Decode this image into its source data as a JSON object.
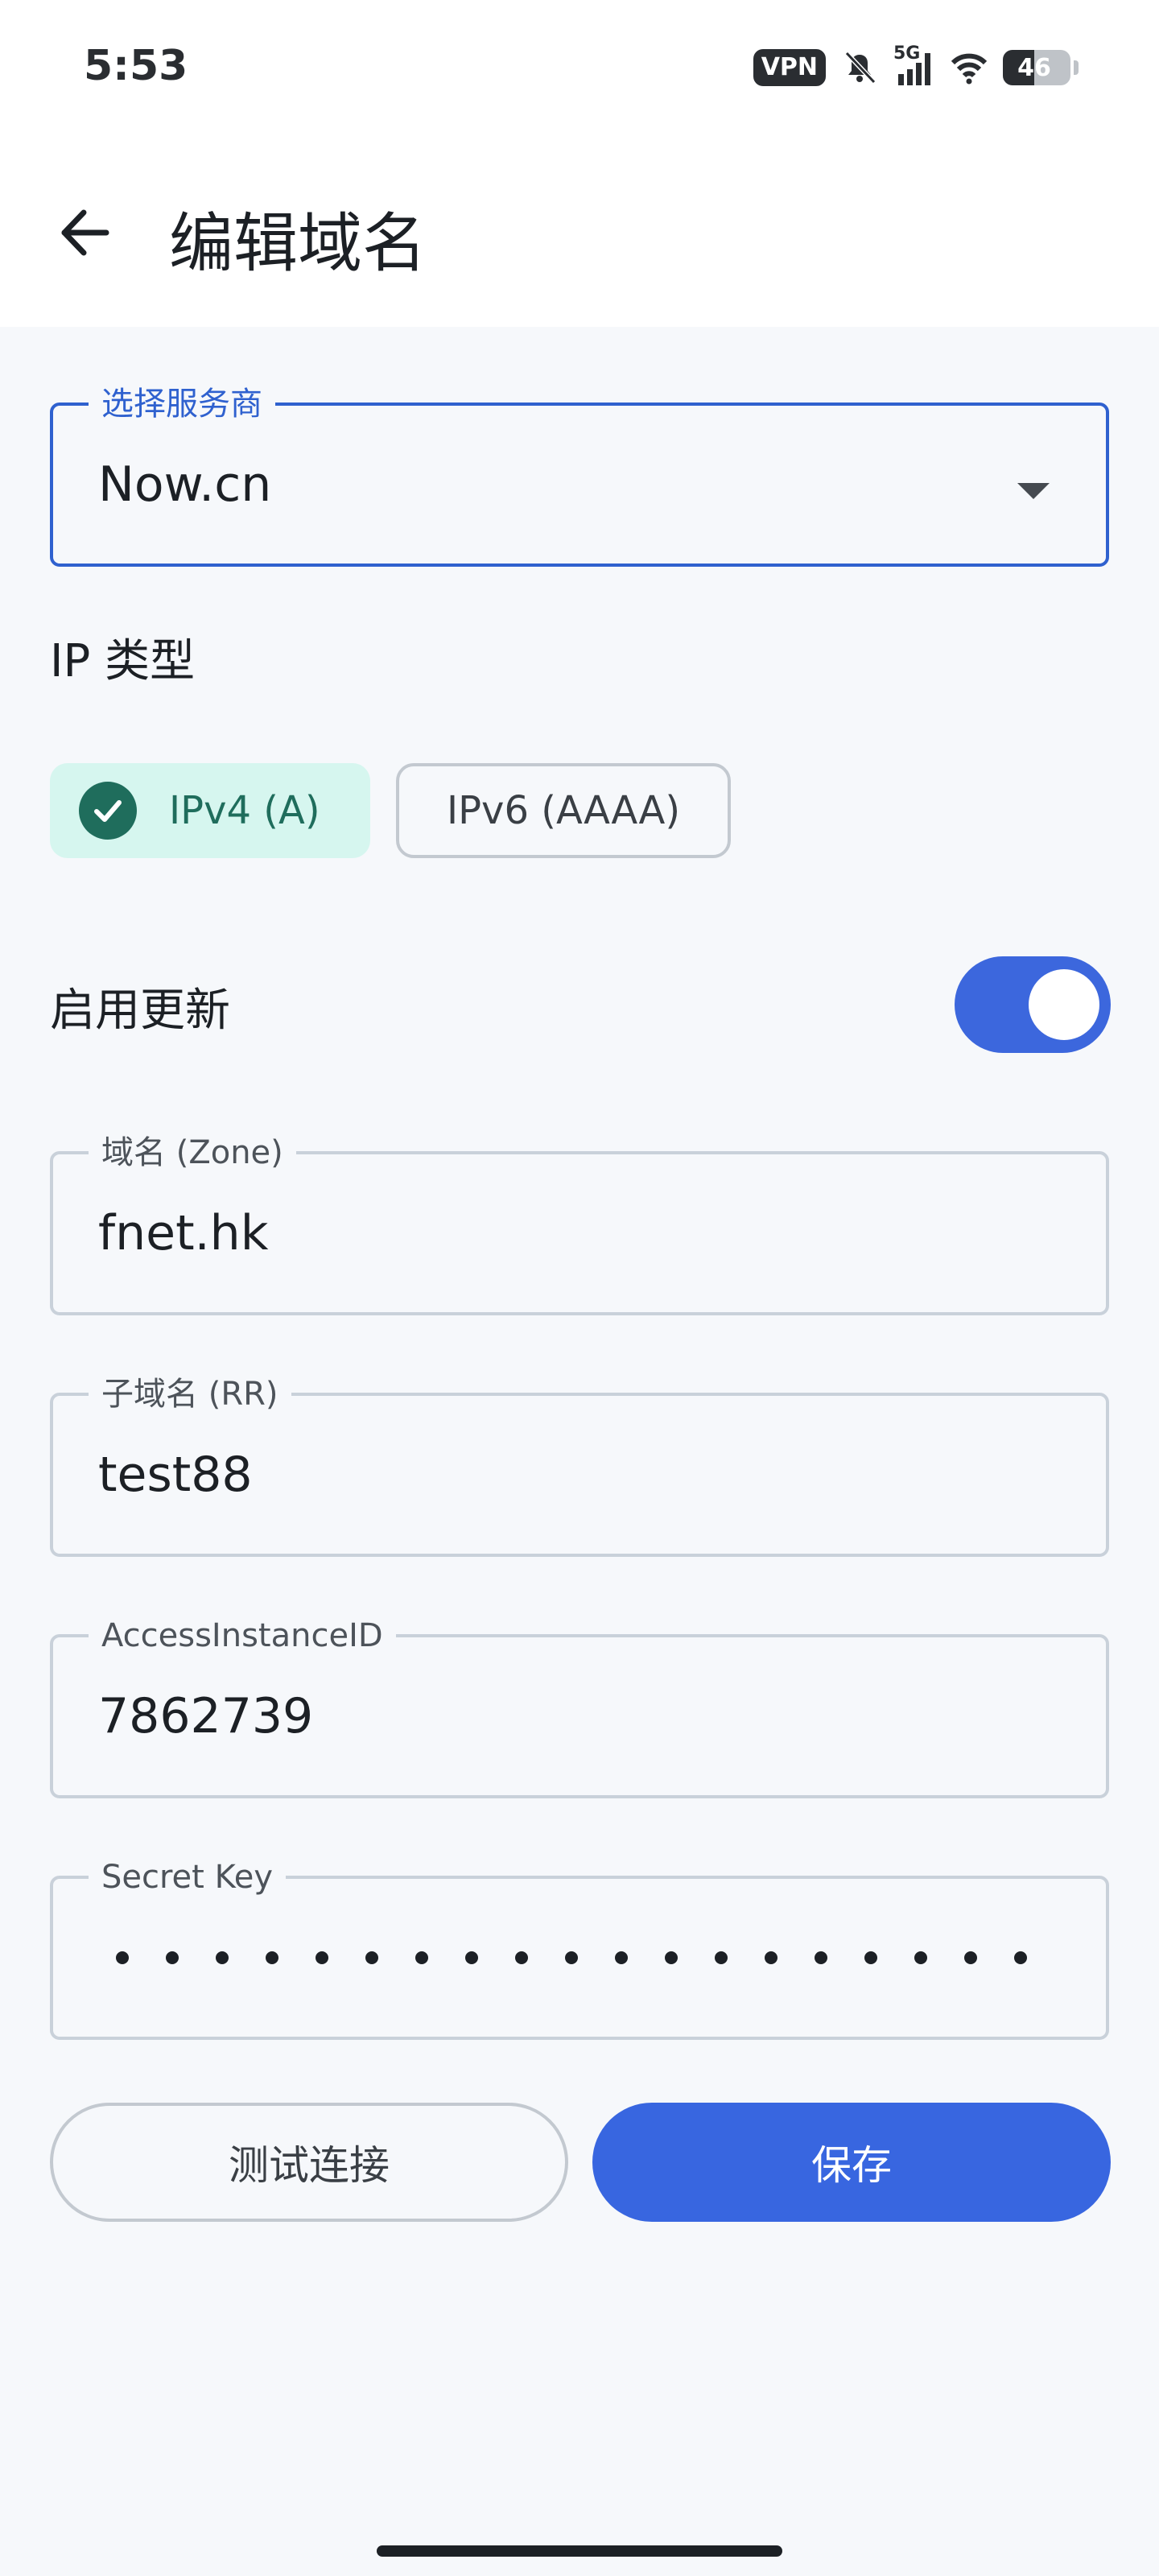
{
  "status_bar": {
    "time": "5:53",
    "vpn": "VPN",
    "network": "5G",
    "battery_level": "46",
    "battery_fraction": 0.46,
    "icons": [
      "vpn-badge",
      "bell-muted-icon",
      "signal-icon",
      "wifi-icon",
      "battery-icon"
    ]
  },
  "header": {
    "back_icon": "arrow-left-icon",
    "title": "编辑域名"
  },
  "provider": {
    "label": "选择服务商",
    "value": "Now.cn"
  },
  "ip_type": {
    "label": "IP 类型",
    "options": [
      {
        "label": "IPv4 (A)",
        "selected": true
      },
      {
        "label": "IPv6 (AAAA)",
        "selected": false
      }
    ]
  },
  "enable_update": {
    "label": "启用更新",
    "on": true
  },
  "zone": {
    "label": "域名 (Zone)",
    "value": "fnet.hk"
  },
  "subdomain": {
    "label": "子域名 (RR)",
    "value": "test88"
  },
  "access_instance": {
    "label": "AccessInstanceID",
    "value": "7862739"
  },
  "secret_key": {
    "label": "Secret Key",
    "masked": true
  },
  "actions": {
    "test_label": "测试连接",
    "save_label": "保存"
  },
  "colors": {
    "accent": "#3866e0",
    "chip_selected_bg": "#d6f6ef",
    "chip_selected_fg": "#1f6d5c",
    "background": "#f6f8fb"
  }
}
